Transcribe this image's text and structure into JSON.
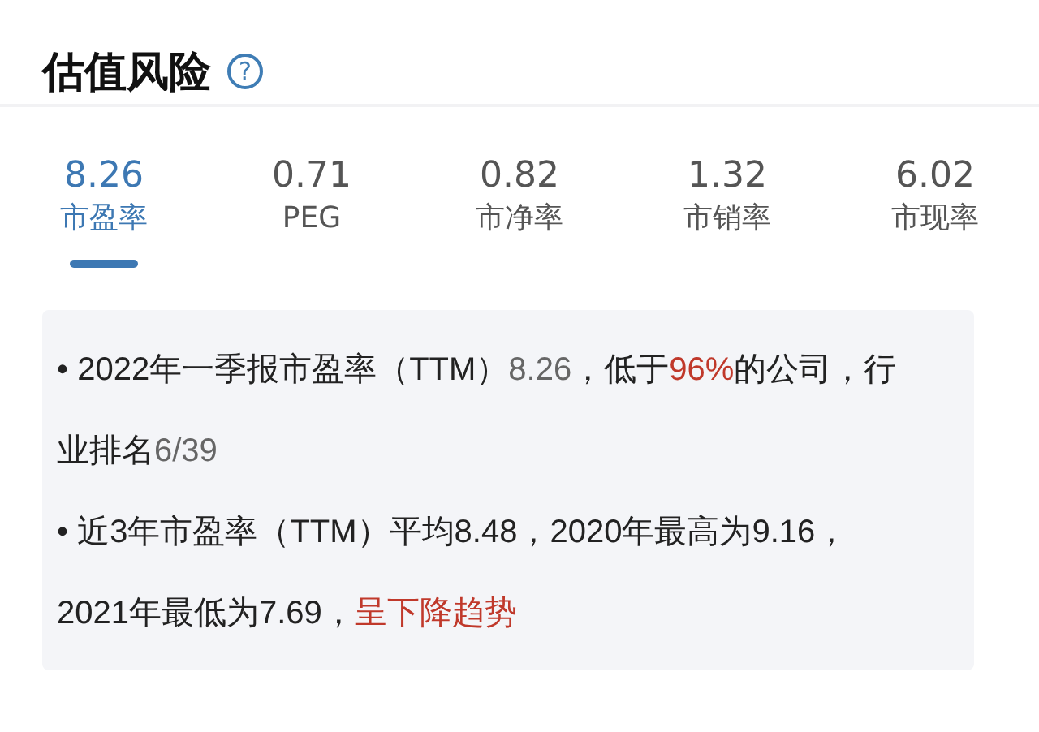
{
  "header": {
    "title": "估值风险",
    "help_icon": "?"
  },
  "tabs": [
    {
      "value": "8.26",
      "label": "市盈率",
      "selected": true
    },
    {
      "value": "0.71",
      "label": "PEG",
      "selected": false
    },
    {
      "value": "0.82",
      "label": "市净率",
      "selected": false
    },
    {
      "value": "1.32",
      "label": "市销率",
      "selected": false
    },
    {
      "value": "6.02",
      "label": "市现率",
      "selected": false
    }
  ],
  "notes": [
    {
      "bullet": "•",
      "segments": [
        {
          "text": "2022年一季报市盈率（TTM）",
          "color": "#222222"
        },
        {
          "text": "8.26",
          "color": "#666666"
        },
        {
          "text": "，低于",
          "color": "#222222"
        },
        {
          "text": "96%",
          "color": "#c0392b"
        },
        {
          "text": "的公司，行业排名",
          "color": "#222222"
        },
        {
          "text": "6/39",
          "color": "#666666"
        }
      ]
    },
    {
      "bullet": "•",
      "segments": [
        {
          "text": "近3年市盈率（TTM）平均8.48，2020年最高为9.16，2021年最低为7.69，",
          "color": "#222222"
        },
        {
          "text": "呈下降趋势",
          "color": "#c0392b"
        }
      ]
    }
  ]
}
